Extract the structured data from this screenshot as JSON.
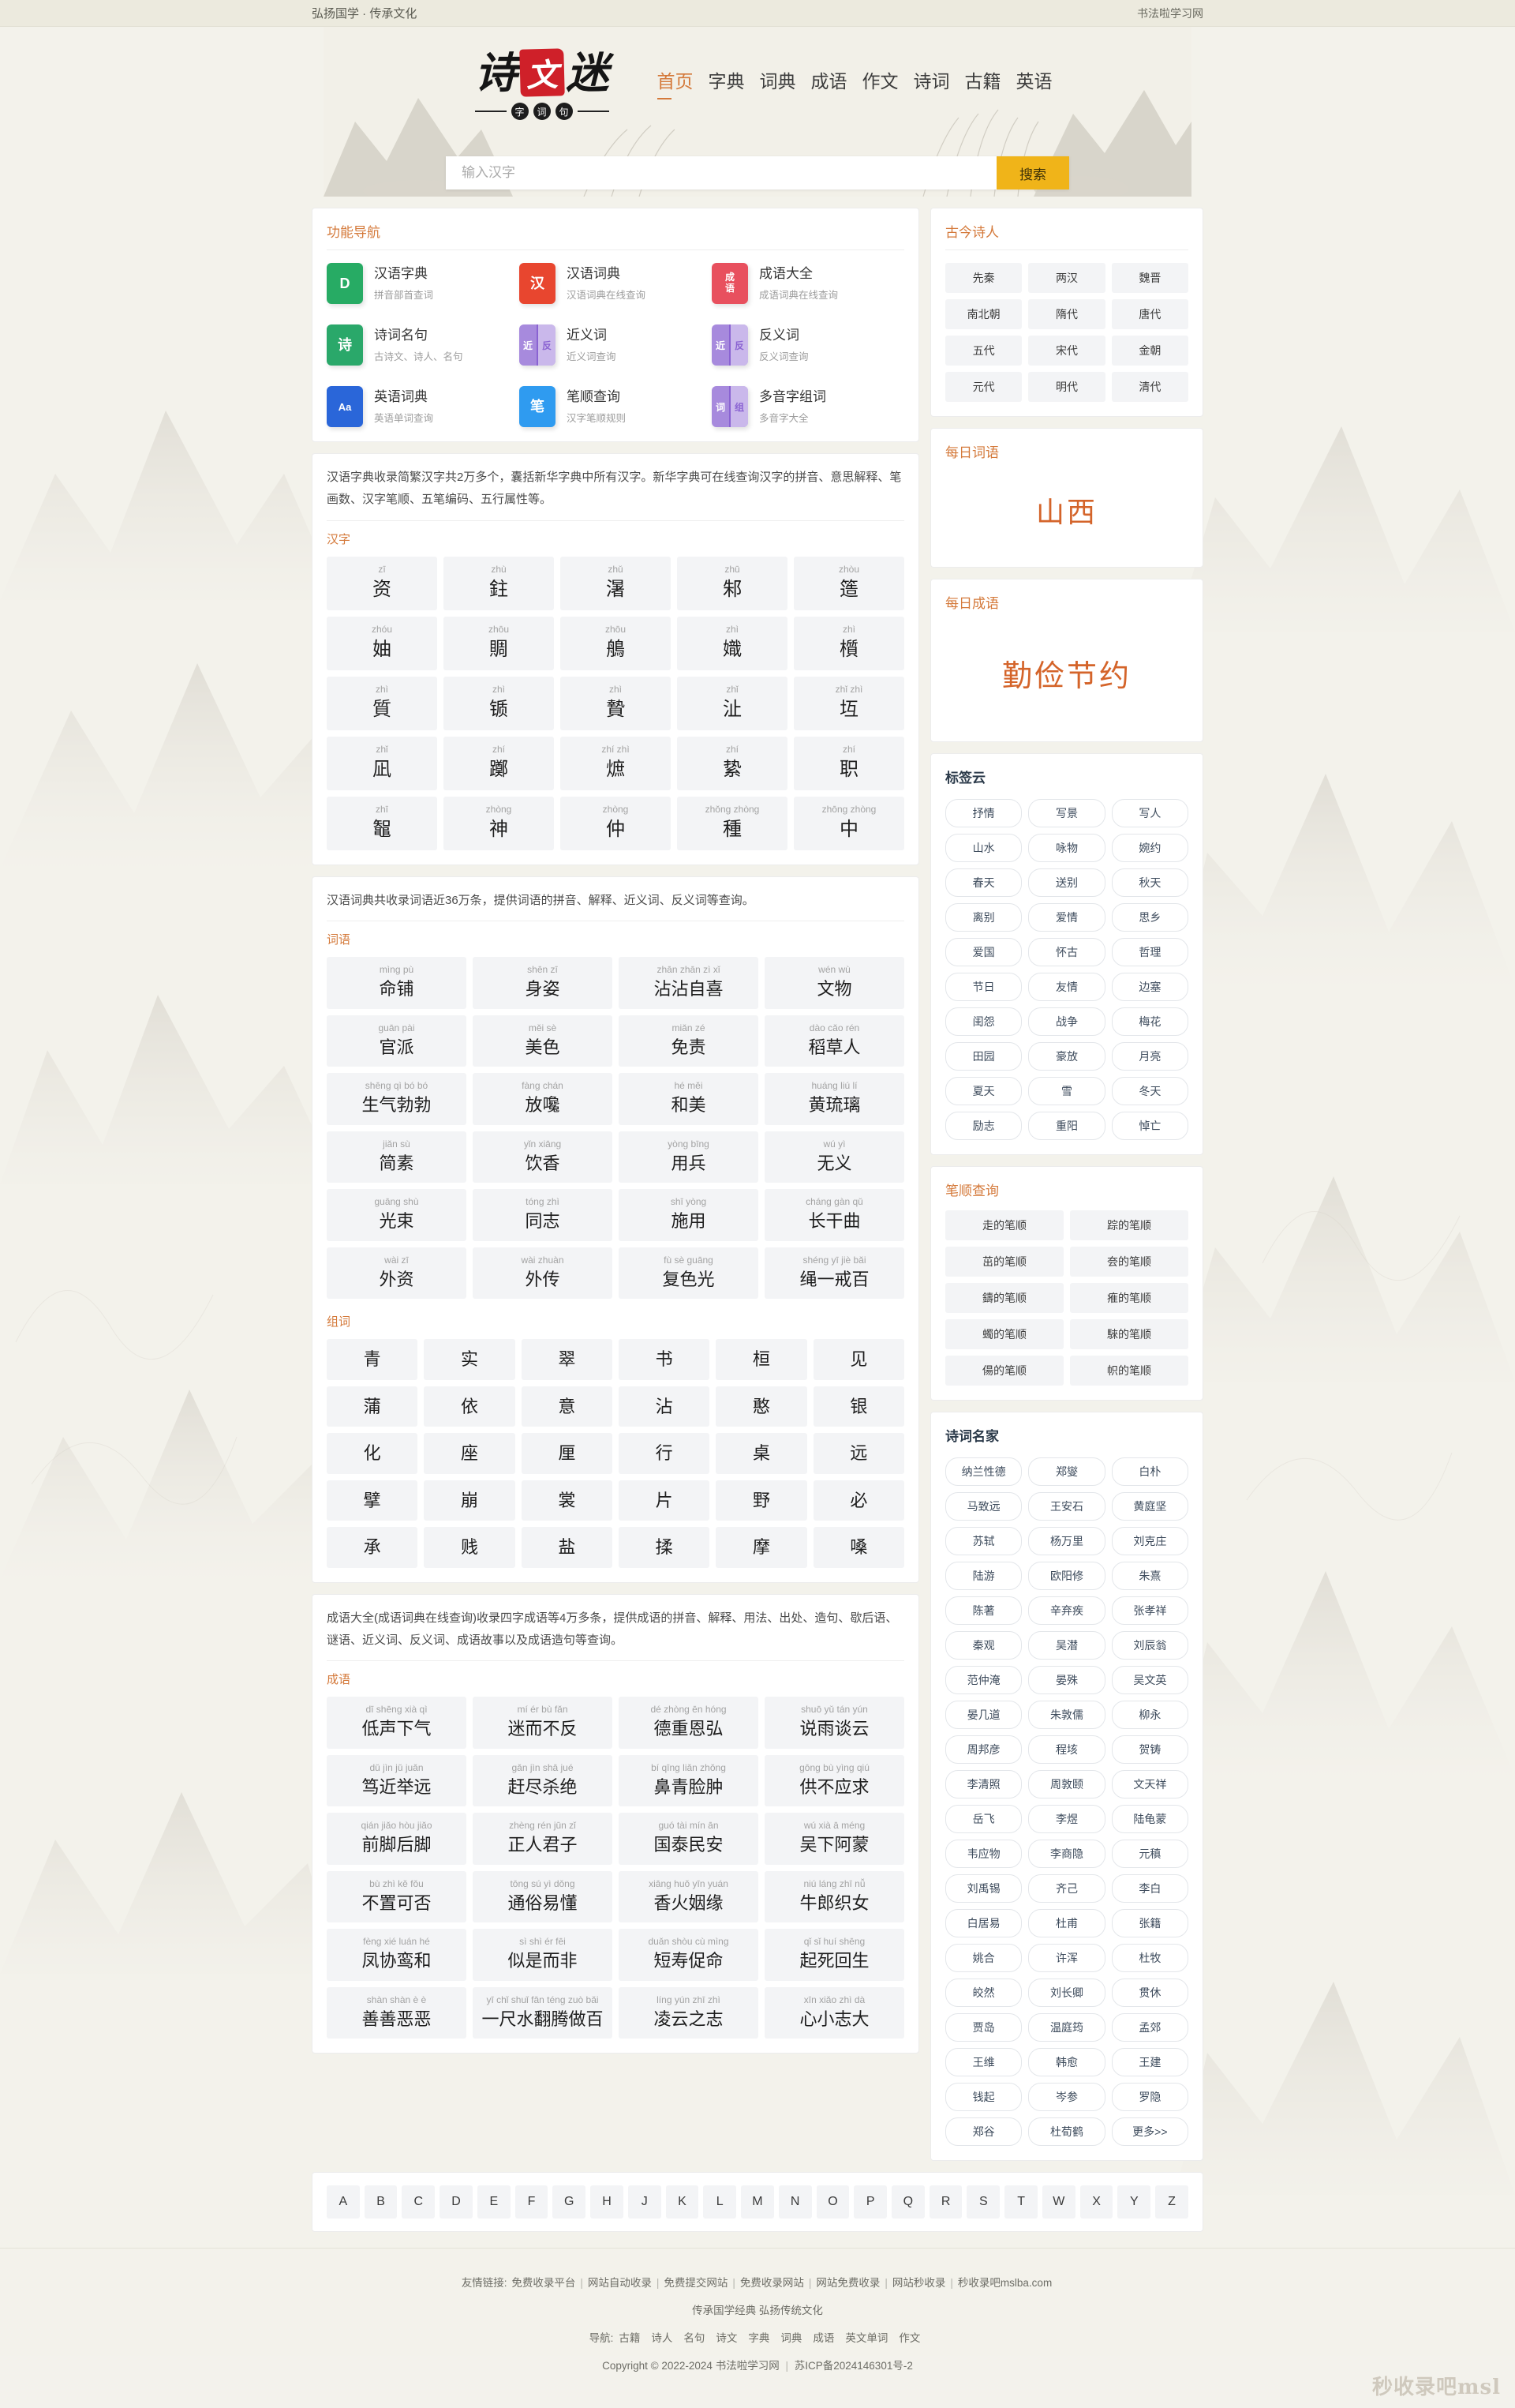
{
  "topbar": {
    "slogan": "弘扬国学 · 传承文化",
    "site_name": "书法啦学习网"
  },
  "brand": {
    "logo_chars": [
      "诗",
      "文",
      "迷"
    ],
    "logo_seal_char": "文",
    "logo_sub": [
      "字",
      "词",
      "句"
    ]
  },
  "nav": {
    "items": [
      {
        "label": "首页",
        "active": true
      },
      {
        "label": "字典",
        "active": false
      },
      {
        "label": "词典",
        "active": false
      },
      {
        "label": "成语",
        "active": false
      },
      {
        "label": "作文",
        "active": false
      },
      {
        "label": "诗词",
        "active": false
      },
      {
        "label": "古籍",
        "active": false
      },
      {
        "label": "英语",
        "active": false
      }
    ]
  },
  "search": {
    "placeholder": "输入汉字",
    "value": "",
    "button_label": "搜索"
  },
  "function_nav": {
    "title": "功能导航",
    "items": [
      {
        "name": "汉语字典",
        "desc": "拼音部首查词",
        "glyph": "D",
        "color": "#27ab64",
        "style": "letter"
      },
      {
        "name": "汉语词典",
        "desc": "汉语词典在线查询",
        "glyph": "汉",
        "color": "#e8462f",
        "style": "book"
      },
      {
        "name": "成语大全",
        "desc": "成语词典在线查询",
        "glyph": "成语",
        "color": "#e8505e",
        "style": "stack"
      },
      {
        "name": "诗词名句",
        "desc": "古诗文、诗人、名句",
        "glyph": "诗",
        "color": "#2aa86a",
        "style": "book"
      },
      {
        "name": "近义词",
        "desc": "近义词查询",
        "glyph": "近反",
        "color": "#8a63d2",
        "style": "split"
      },
      {
        "name": "反义词",
        "desc": "反义词查询",
        "glyph": "近反",
        "color": "#8a63d2",
        "style": "split"
      },
      {
        "name": "英语词典",
        "desc": "英语单词查询",
        "glyph": "Aa",
        "color": "#2a66d9",
        "style": "letter"
      },
      {
        "name": "笔顺查询",
        "desc": "汉字笔顺规则",
        "glyph": "笔",
        "color": "#2f9bf0",
        "style": "pen"
      },
      {
        "name": "多音字组词",
        "desc": "多音字大全",
        "glyph": "词组",
        "color": "#8a63d2",
        "style": "split"
      }
    ]
  },
  "dict_section": {
    "intro": "汉语字典收录简繁汉字共2万多个，囊括新华字典中所有汉字。新华字典可在线查询汉字的拼音、意思解释、笔画数、汉字笔顺、五笔编码、五行属性等。",
    "sub_title": "汉字",
    "items": [
      {
        "pinyin": "zī",
        "char": "资"
      },
      {
        "pinyin": "zhù",
        "char": "鉒"
      },
      {
        "pinyin": "zhǔ",
        "char": "濐"
      },
      {
        "pinyin": "zhū",
        "char": "邾"
      },
      {
        "pinyin": "zhòu",
        "char": "簉"
      },
      {
        "pinyin": "zhóu",
        "char": "妯"
      },
      {
        "pinyin": "zhōu",
        "char": "賙"
      },
      {
        "pinyin": "zhōu",
        "char": "鵃"
      },
      {
        "pinyin": "zhì",
        "char": "嬂"
      },
      {
        "pinyin": "zhì",
        "char": "櫍"
      },
      {
        "pinyin": "zhì",
        "char": "質"
      },
      {
        "pinyin": "zhì",
        "char": "锧"
      },
      {
        "pinyin": "zhì",
        "char": "贄"
      },
      {
        "pinyin": "zhǐ",
        "char": "沚"
      },
      {
        "pinyin": "zhǐ zhì",
        "char": "坘"
      },
      {
        "pinyin": "zhǐ",
        "char": "凪"
      },
      {
        "pinyin": "zhí",
        "char": "躑"
      },
      {
        "pinyin": "zhí zhì",
        "char": "熫"
      },
      {
        "pinyin": "zhí",
        "char": "絷"
      },
      {
        "pinyin": "zhí",
        "char": "职"
      },
      {
        "pinyin": "zhī",
        "char": "鼅"
      },
      {
        "pinyin": "zhòng",
        "char": "神"
      },
      {
        "pinyin": "zhòng",
        "char": "仲"
      },
      {
        "pinyin": "zhǒng zhòng",
        "char": "種"
      },
      {
        "pinyin": "zhōng zhòng",
        "char": "中"
      }
    ]
  },
  "word_section": {
    "intro": "汉语词典共收录词语近36万条，提供词语的拼音、解释、近义词、反义词等查询。",
    "sub_title": "词语",
    "items": [
      {
        "pinyin": "mìng pù",
        "word": "命铺"
      },
      {
        "pinyin": "shēn zī",
        "word": "身姿"
      },
      {
        "pinyin": "zhān zhān zì xǐ",
        "word": "沾沾自喜"
      },
      {
        "pinyin": "wén wù",
        "word": "文物"
      },
      {
        "pinyin": "guān pài",
        "word": "官派"
      },
      {
        "pinyin": "měi sè",
        "word": "美色"
      },
      {
        "pinyin": "miǎn zé",
        "word": "免责"
      },
      {
        "pinyin": "dào cǎo rén",
        "word": "稻草人"
      },
      {
        "pinyin": "shēng qì bó bó",
        "word": "生气勃勃"
      },
      {
        "pinyin": "fàng chán",
        "word": "放嚵"
      },
      {
        "pinyin": "hé měi",
        "word": "和美"
      },
      {
        "pinyin": "huáng liú lí",
        "word": "黄琉璃"
      },
      {
        "pinyin": "jiǎn sù",
        "word": "简素"
      },
      {
        "pinyin": "yǐn xiāng",
        "word": "饮香"
      },
      {
        "pinyin": "yòng bīng",
        "word": "用兵"
      },
      {
        "pinyin": "wú yì",
        "word": "无义"
      },
      {
        "pinyin": "guāng shù",
        "word": "光束"
      },
      {
        "pinyin": "tóng zhì",
        "word": "同志"
      },
      {
        "pinyin": "shī yòng",
        "word": "施用"
      },
      {
        "pinyin": "cháng gàn qǔ",
        "word": "长干曲"
      },
      {
        "pinyin": "wài zī",
        "word": "外资"
      },
      {
        "pinyin": "wài zhuàn",
        "word": "外传"
      },
      {
        "pinyin": "fù sè guāng",
        "word": "复色光"
      },
      {
        "pinyin": "shéng yī jiè bǎi",
        "word": "绳一戒百"
      }
    ],
    "zu_ci_title": "组词",
    "zu_ci": [
      "青",
      "实",
      "翠",
      "书",
      "桓",
      "见",
      "蒲",
      "依",
      "意",
      "沾",
      "憨",
      "银",
      "化",
      "座",
      "厘",
      "行",
      "桌",
      "远",
      "擘",
      "崩",
      "裳",
      "片",
      "野",
      "必",
      "承",
      "贱",
      "盐",
      "揉",
      "摩",
      "嗓"
    ]
  },
  "idiom_section": {
    "intro": "成语大全(成语词典在线查询)收录四字成语等4万多条，提供成语的拼音、解释、用法、出处、造句、歇后语、谜语、近义词、反义词、成语故事以及成语造句等查询。",
    "sub_title": "成语",
    "items": [
      {
        "pinyin": "dī shēng xià qì",
        "idiom": "低声下气"
      },
      {
        "pinyin": "mí ér bù fǎn",
        "idiom": "迷而不反"
      },
      {
        "pinyin": "dé zhòng ēn hóng",
        "idiom": "德重恩弘"
      },
      {
        "pinyin": "shuō yǔ tán yún",
        "idiom": "说雨谈云"
      },
      {
        "pinyin": "dǔ jìn jǔ juǎn",
        "idiom": "笃近举远"
      },
      {
        "pinyin": "gǎn jìn shā jué",
        "idiom": "赶尽杀绝"
      },
      {
        "pinyin": "bí qīng liǎn zhǒng",
        "idiom": "鼻青脸肿"
      },
      {
        "pinyin": "gōng bù yìng qiú",
        "idiom": "供不应求"
      },
      {
        "pinyin": "qián jiǎo hòu jiǎo",
        "idiom": "前脚后脚"
      },
      {
        "pinyin": "zhèng rén jūn zǐ",
        "idiom": "正人君子"
      },
      {
        "pinyin": "guó tài mín ān",
        "idiom": "国泰民安"
      },
      {
        "pinyin": "wú xià ā méng",
        "idiom": "吴下阿蒙"
      },
      {
        "pinyin": "bù zhì kě fǒu",
        "idiom": "不置可否"
      },
      {
        "pinyin": "tōng sú yì dǒng",
        "idiom": "通俗易懂"
      },
      {
        "pinyin": "xiāng huǒ yīn yuán",
        "idiom": "香火姻缘"
      },
      {
        "pinyin": "niú láng zhī nǚ",
        "idiom": "牛郎织女"
      },
      {
        "pinyin": "fèng xié luán hé",
        "idiom": "凤协鸾和"
      },
      {
        "pinyin": "sì shì ér fēi",
        "idiom": "似是而非"
      },
      {
        "pinyin": "duǎn shòu cù mìng",
        "idiom": "短寿促命"
      },
      {
        "pinyin": "qǐ sǐ huí shēng",
        "idiom": "起死回生"
      },
      {
        "pinyin": "shàn shàn è è",
        "idiom": "善善恶恶"
      },
      {
        "pinyin": "yī chǐ shuǐ fān téng zuò bǎi",
        "idiom": "一尺水翻腾做百"
      },
      {
        "pinyin": "líng yún zhī zhì",
        "idiom": "凌云之志"
      },
      {
        "pinyin": "xīn xiǎo zhì dà",
        "idiom": "心小志大"
      }
    ]
  },
  "sidebar": {
    "poets_era": {
      "title": "古今诗人",
      "items": [
        "先秦",
        "两汉",
        "魏晋",
        "南北朝",
        "隋代",
        "唐代",
        "五代",
        "宋代",
        "金朝",
        "元代",
        "明代",
        "清代"
      ]
    },
    "daily_word": {
      "title": "每日词语",
      "value": "山西"
    },
    "daily_idiom": {
      "title": "每日成语",
      "value": "勤俭节约"
    },
    "tag_cloud": {
      "title": "标签云",
      "items": [
        "抒情",
        "写景",
        "写人",
        "山水",
        "咏物",
        "婉约",
        "春天",
        "送别",
        "秋天",
        "离别",
        "爱情",
        "思乡",
        "爱国",
        "怀古",
        "哲理",
        "节日",
        "友情",
        "边塞",
        "闺怨",
        "战争",
        "梅花",
        "田园",
        "豪放",
        "月亮",
        "夏天",
        "雪",
        "冬天",
        "励志",
        "重阳",
        "悼亡"
      ]
    },
    "stroke_order": {
      "title": "笔顺查询",
      "items": [
        "走的笔顺",
        "踪的笔顺",
        "茁的笔顺",
        "夽的笔顺",
        "鑄的笔顺",
        "痽的笔顺",
        "蠋的笔顺",
        "騋的笔顺",
        "偒的笔顺",
        "帜的笔顺"
      ]
    },
    "famous_poets": {
      "title": "诗词名家",
      "items": [
        "纳兰性德",
        "郑燮",
        "白朴",
        "马致远",
        "王安石",
        "黄庭坚",
        "苏轼",
        "杨万里",
        "刘克庄",
        "陆游",
        "欧阳修",
        "朱熹",
        "陈著",
        "辛弃疾",
        "张孝祥",
        "秦观",
        "吴潜",
        "刘辰翁",
        "范仲淹",
        "晏殊",
        "吴文英",
        "晏几道",
        "朱敦儒",
        "柳永",
        "周邦彦",
        "程垓",
        "贺铸",
        "李清照",
        "周敦颐",
        "文天祥",
        "岳飞",
        "李煜",
        "陆龟蒙",
        "韦应物",
        "李商隐",
        "元稹",
        "刘禹锡",
        "齐己",
        "李白",
        "白居易",
        "杜甫",
        "张籍",
        "姚合",
        "许浑",
        "杜牧",
        "皎然",
        "刘长卿",
        "贯休",
        "贾岛",
        "温庭筠",
        "孟郊",
        "王维",
        "韩愈",
        "王建",
        "钱起",
        "岑参",
        "罗隐",
        "郑谷",
        "杜荀鹤",
        "更多>>"
      ]
    }
  },
  "alphabet": [
    "A",
    "B",
    "C",
    "D",
    "E",
    "F",
    "G",
    "H",
    "J",
    "K",
    "L",
    "M",
    "N",
    "O",
    "P",
    "Q",
    "R",
    "S",
    "T",
    "W",
    "X",
    "Y",
    "Z"
  ],
  "footer": {
    "friend_label": "友情链接:",
    "friend_links": [
      "免费收录平台",
      "网站自动收录",
      "免费提交网站",
      "免费收录网站",
      "网站免费收录",
      "网站秒收录",
      "秒收录吧mslba.com"
    ],
    "tagline": "传承国学经典 弘扬传统文化",
    "nav_label": "导航:",
    "nav_links": [
      "古籍",
      "诗人",
      "名句",
      "诗文",
      "字典",
      "词典",
      "成语",
      "英文单词",
      "作文"
    ],
    "copyright": "Copyright © 2022-2024 书法啦学习网",
    "icp": "苏ICP备2024146301号-2"
  },
  "watermark": "秒收录吧msl"
}
